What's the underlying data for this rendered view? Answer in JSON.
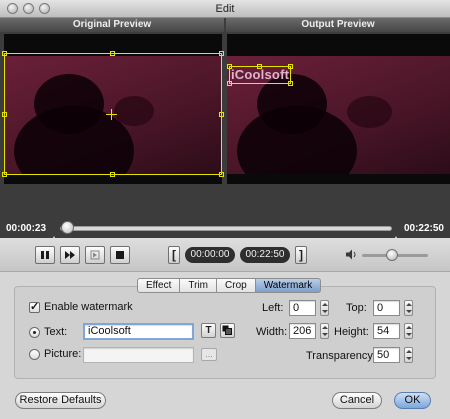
{
  "window": {
    "title": "Edit"
  },
  "preview": {
    "original_label": "Original Preview",
    "output_label": "Output Preview",
    "watermark_overlay_text": "iCoolsoft",
    "current_time": "00:00:23",
    "total_time": "00:22:50",
    "playback_progress": 0.02
  },
  "controls": {
    "start_time": "00:00:00",
    "end_time": "00:22:50",
    "bracket_open": "[",
    "bracket_close": "]",
    "volume_level": 0.4
  },
  "tabs": [
    {
      "label": "Effect",
      "active": false
    },
    {
      "label": "Trim",
      "active": false
    },
    {
      "label": "Crop",
      "active": false
    },
    {
      "label": "Watermark",
      "active": true
    }
  ],
  "watermark": {
    "enable_label": "Enable watermark",
    "enabled": true,
    "text_label": "Text:",
    "text_value": "iCoolsoft",
    "text_selected": true,
    "picture_label": "Picture:",
    "picture_value": "",
    "browse_label": "...",
    "font_button": "T",
    "left_label": "Left:",
    "left_value": "0",
    "top_label": "Top:",
    "top_value": "0",
    "width_label": "Width:",
    "width_value": "206",
    "height_label": "Height:",
    "height_value": "54",
    "transparency_label": "Transparency:",
    "transparency_value": "50"
  },
  "footer": {
    "restore_label": "Restore Defaults",
    "cancel_label": "Cancel",
    "ok_label": "OK"
  }
}
